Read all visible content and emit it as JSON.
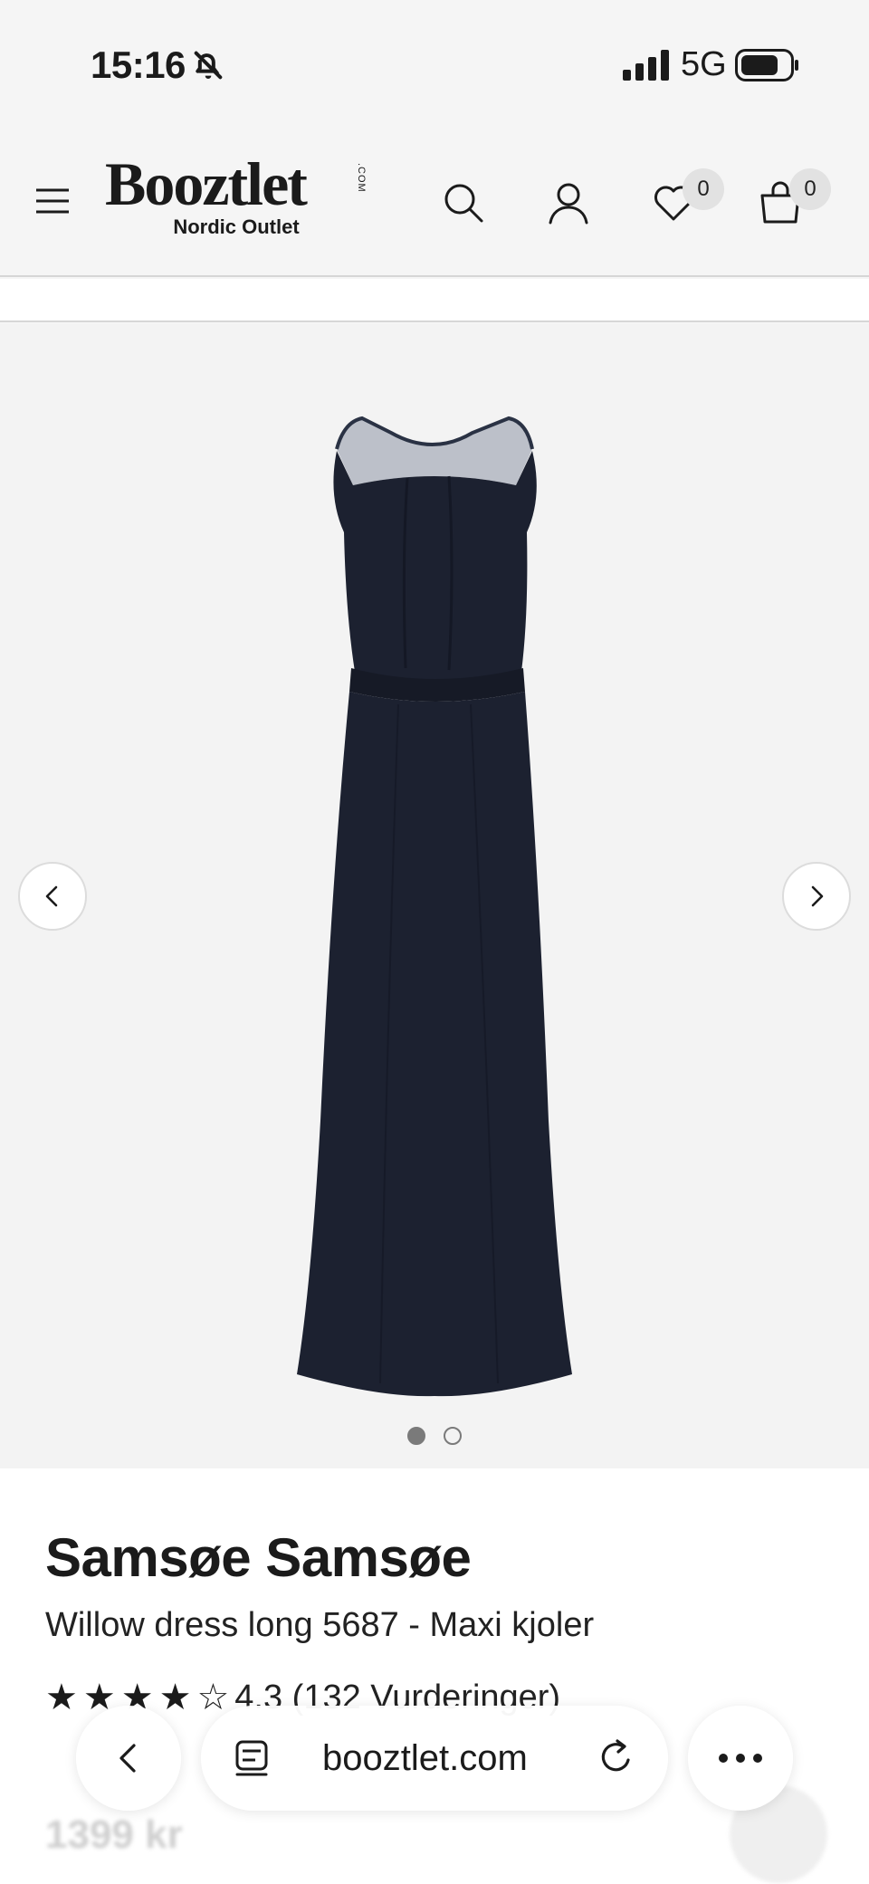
{
  "status_bar": {
    "time": "15:16",
    "network": "5G",
    "icons": [
      "bell-slash-icon",
      "signal-icon",
      "battery-icon"
    ]
  },
  "header": {
    "logo_text": "Booztlet",
    "logo_com": ".COM",
    "logo_subtitle": "Nordic Outlet",
    "wishlist_count": "0",
    "cart_count": "0",
    "icons": [
      "menu-icon",
      "search-icon",
      "user-icon",
      "heart-icon",
      "bag-icon"
    ]
  },
  "gallery": {
    "image_alt": "Navy sleeveless maxi dress with lace neckline",
    "dress_color": "#1c2130",
    "slide_count": 2,
    "active_slide": 1
  },
  "product": {
    "brand": "Samsøe Samsøe",
    "name": "Willow dress long 5687 - Maxi kjoler",
    "rating": 4.3,
    "rating_text": "4.3 (132 Vurderinger)",
    "price": "1399 kr"
  },
  "browser": {
    "url": "booztlet.com"
  },
  "colors": {
    "background": "#f5f5f5",
    "text": "#1b1b1b",
    "badge": "#e2e2e2"
  }
}
